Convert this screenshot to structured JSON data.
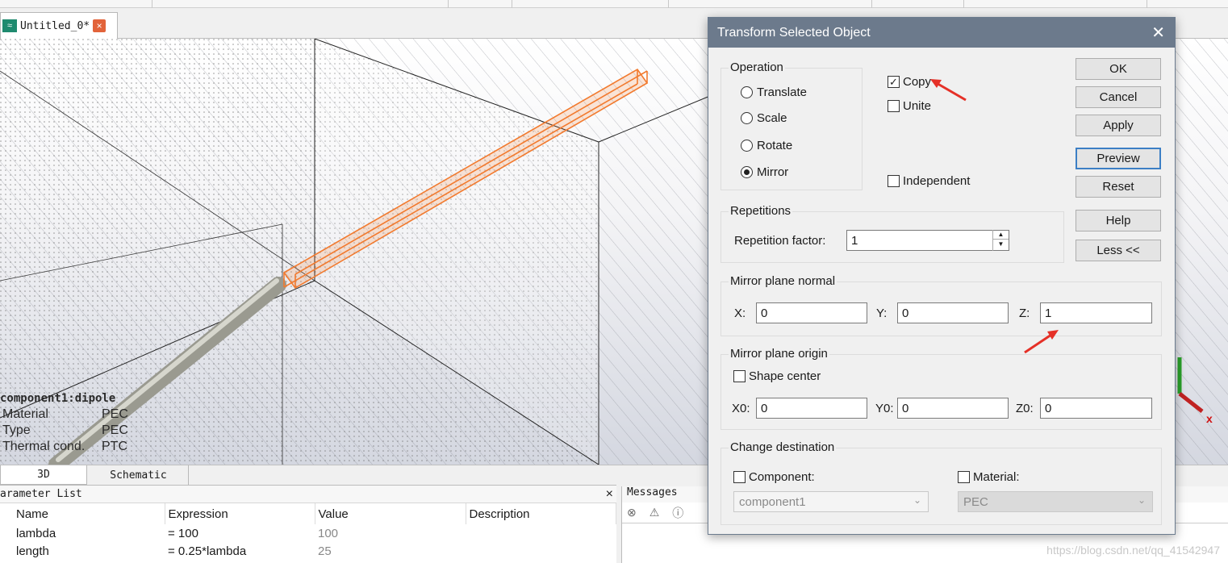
{
  "document_tab": {
    "title": "Untitled_0*",
    "close": "×"
  },
  "view_tabs": [
    "3D",
    "Schematic"
  ],
  "info_box": {
    "heading": "component1:dipole",
    "rows": [
      {
        "key": "Material",
        "value": "PEC"
      },
      {
        "key": "Type",
        "value": "PEC"
      },
      {
        "key": "Thermal cond.",
        "value": "PTC"
      }
    ]
  },
  "parameter_list": {
    "title": "arameter List",
    "close": "×",
    "columns": [
      "Name",
      "Expression",
      "Value",
      "Description"
    ],
    "rows": [
      {
        "name": "lambda",
        "expression": "= 100",
        "value": "100",
        "description": ""
      },
      {
        "name": "length",
        "expression": "= 0.25*lambda",
        "value": "25",
        "description": ""
      }
    ]
  },
  "messages": {
    "title": "Messages",
    "watermark": "https://blog.csdn.net/qq_41542947"
  },
  "axis_label": "x",
  "dialog": {
    "title": "Transform Selected Object",
    "close": "✕",
    "operation": {
      "label": "Operation",
      "options": [
        "Translate",
        "Scale",
        "Rotate",
        "Mirror"
      ],
      "selected": "Mirror"
    },
    "checks": {
      "copy": {
        "label": "Copy",
        "checked": true
      },
      "unite": {
        "label": "Unite",
        "checked": false
      },
      "independent": {
        "label": "Independent",
        "checked": false
      }
    },
    "repetitions": {
      "label": "Repetitions",
      "factor_label": "Repetition factor:",
      "factor_value": "1"
    },
    "mirror_normal": {
      "label": "Mirror plane normal",
      "x_label": "X:",
      "x": "0",
      "y_label": "Y:",
      "y": "0",
      "z_label": "Z:",
      "z": "1"
    },
    "mirror_origin": {
      "label": "Mirror plane origin",
      "shape_center": {
        "label": "Shape center",
        "checked": false
      },
      "x0_label": "X0:",
      "x0": "0",
      "y0_label": "Y0:",
      "y0": "0",
      "z0_label": "Z0:",
      "z0": "0"
    },
    "destination": {
      "label": "Change destination",
      "component": {
        "label": "Component:",
        "checked": false,
        "value": "component1"
      },
      "material": {
        "label": "Material:",
        "checked": false,
        "value": "PEC"
      }
    },
    "buttons": {
      "ok": "OK",
      "cancel": "Cancel",
      "apply": "Apply",
      "preview": "Preview",
      "reset": "Reset",
      "help": "Help",
      "less": "Less <<"
    }
  },
  "colors": {
    "highlight": "#f27a2e",
    "titlebar": "#6c7a8c",
    "annotation": "#e53027"
  }
}
